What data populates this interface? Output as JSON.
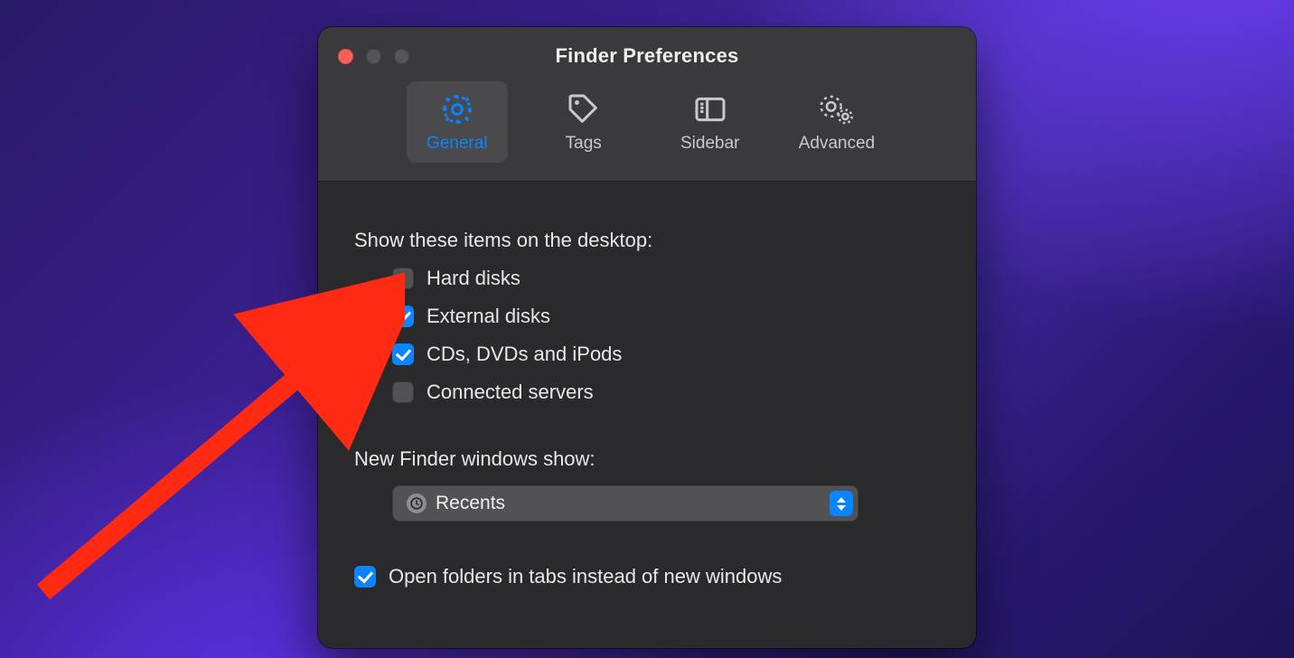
{
  "window": {
    "title": "Finder Preferences"
  },
  "toolbar": {
    "tabs": [
      {
        "label": "General",
        "active": true
      },
      {
        "label": "Tags",
        "active": false
      },
      {
        "label": "Sidebar",
        "active": false
      },
      {
        "label": "Advanced",
        "active": false
      }
    ]
  },
  "desktop_items": {
    "title": "Show these items on the desktop:",
    "items": [
      {
        "label": "Hard disks",
        "checked": false
      },
      {
        "label": "External disks",
        "checked": true
      },
      {
        "label": "CDs, DVDs and iPods",
        "checked": true
      },
      {
        "label": "Connected servers",
        "checked": false
      }
    ]
  },
  "new_windows": {
    "title": "New Finder windows show:",
    "selected": "Recents"
  },
  "open_in_tabs": {
    "label": "Open folders in tabs instead of new windows",
    "checked": true
  }
}
